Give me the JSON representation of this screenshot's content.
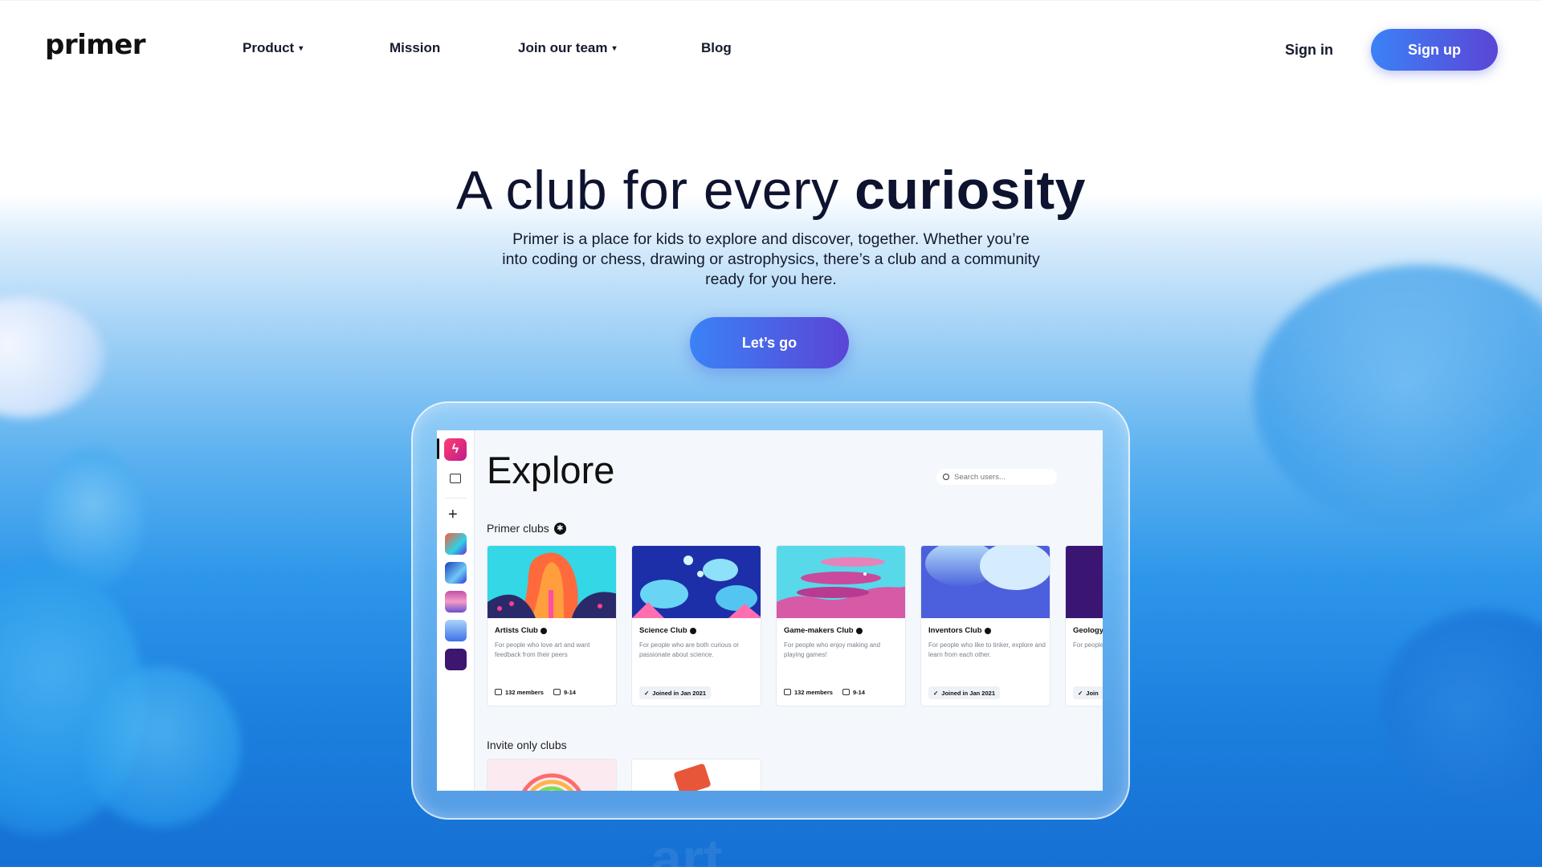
{
  "brand": {
    "logo_text": "primer",
    "accent_start": "#3b82f6",
    "accent_end": "#5b45d6"
  },
  "nav": {
    "items": [
      {
        "label": "Product",
        "has_dropdown": true
      },
      {
        "label": "Mission",
        "has_dropdown": false
      },
      {
        "label": "Join our team",
        "has_dropdown": true
      },
      {
        "label": "Blog",
        "has_dropdown": false
      }
    ],
    "sign_in": "Sign in",
    "sign_up": "Sign up"
  },
  "hero": {
    "title_plain": "A club for every ",
    "title_bold": "curiosity",
    "subtitle": "Primer is a place for kids to explore and discover, together. Whether you’re into coding or chess, drawing or astrophysics, there’s a club and a community ready for you here.",
    "cta": "Let’s go"
  },
  "app": {
    "sidebar_icons": [
      "primer-app-icon",
      "calendar-icon",
      "plus-icon",
      "artists-club-icon",
      "science-club-icon",
      "game-makers-club-icon",
      "inventors-club-icon",
      "geology-club-icon"
    ],
    "title": "Explore",
    "search_placeholder": "Search users...",
    "primer_clubs_label": "Primer clubs",
    "invite_clubs_label": "Invite only clubs",
    "clubs": [
      {
        "name": "Artists Club",
        "desc": "For people who love art and want feedback from their peers",
        "members": "132 members",
        "ages": "9-14",
        "joined": null
      },
      {
        "name": "Science Club",
        "desc": "For people who are both curious or passionate about science.",
        "members": null,
        "ages": null,
        "joined": "Joined in Jan 2021"
      },
      {
        "name": "Game-makers Club",
        "desc": "For people who enjoy making and playing games!",
        "members": "132 members",
        "ages": "9-14",
        "joined": null
      },
      {
        "name": "Inventors Club",
        "desc": "For people who like to tinker, explore and learn from each other.",
        "members": null,
        "ages": null,
        "joined": "Joined in Jan 2021"
      },
      {
        "name": "Geology",
        "desc": "For people and learn",
        "members": null,
        "ages": null,
        "joined": "Join"
      }
    ]
  },
  "background_word": "art"
}
